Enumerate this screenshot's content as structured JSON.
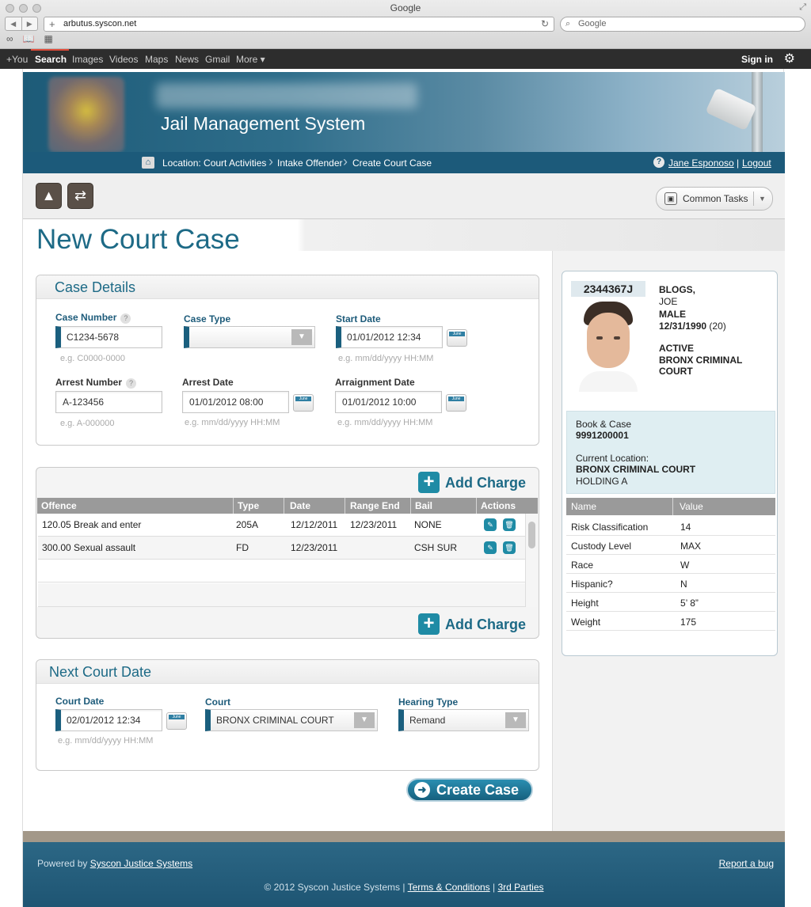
{
  "browser": {
    "window_title": "Google",
    "url": "arbutus.syscon.net",
    "search_placeholder": "Google",
    "google_bar": {
      "items": [
        "+You",
        "Search",
        "Images",
        "Videos",
        "Maps",
        "News",
        "Gmail",
        "More ▾"
      ],
      "signin": "Sign in"
    }
  },
  "app": {
    "system_title": "Jail Management System",
    "breadcrumbs": [
      "Location: Court Activities",
      "Intake Offender",
      "Create Court Case"
    ],
    "user_name": "Jane Esponoso",
    "logout": "Logout",
    "common_tasks": "Common Tasks",
    "page_title": "New Court Case"
  },
  "case_details": {
    "title": "Case Details",
    "case_number": {
      "label": "Case Number",
      "value": "C1234-5678",
      "hint": "e.g. C0000-0000"
    },
    "case_type": {
      "label": "Case Type",
      "value": ""
    },
    "start_date": {
      "label": "Start Date",
      "value": "01/01/2012  12:34",
      "hint": "e.g. mm/dd/yyyy  HH:MM"
    },
    "arrest_number": {
      "label": "Arrest Number",
      "value": "A-123456",
      "hint": "e.g. A-000000"
    },
    "arrest_date": {
      "label": "Arrest Date",
      "value": "01/01/2012  08:00",
      "hint": "e.g. mm/dd/yyyy  HH:MM"
    },
    "arraignment_date": {
      "label": "Arraignment Date",
      "value": "01/01/2012  10:00",
      "hint": "e.g. mm/dd/yyyy  HH:MM"
    }
  },
  "charges": {
    "add_label": "Add Charge",
    "columns": [
      "Offence",
      "Type",
      "Date",
      "Range End",
      "Bail",
      "Actions"
    ],
    "rows": [
      {
        "offence": "120.05 Break and enter",
        "type": "205A",
        "date": "12/12/2011",
        "range_end": "12/23/2011",
        "bail": "NONE"
      },
      {
        "offence": "300.00 Sexual assault",
        "type": "FD",
        "date": "12/23/2011",
        "range_end": "",
        "bail": "CSH SUR"
      }
    ]
  },
  "next_court": {
    "title": "Next Court Date",
    "court_date": {
      "label": "Court Date",
      "value": "02/01/2012  12:34",
      "hint": "e.g. mm/dd/yyyy  HH:MM"
    },
    "court": {
      "label": "Court",
      "value": "BRONX CRIMINAL COURT"
    },
    "hearing_type": {
      "label": "Hearing Type",
      "value": "Remand"
    }
  },
  "create_case": "Create Case",
  "offender": {
    "id": "2344367J",
    "last_name": "BLOGS,",
    "first_name": "JOE",
    "sex": "MALE",
    "dob": "12/31/1990",
    "age": "(20)",
    "status": "ACTIVE",
    "location_line1": "BRONX CRIMINAL",
    "location_line2": "COURT",
    "book_case_label": "Book & Case",
    "book_case": "9991200001",
    "current_location_label": "Current Location:",
    "current_location": "BRONX CRIMINAL COURT",
    "sub_location": "HOLDING A",
    "attr_header": {
      "name": "Name",
      "value": "Value"
    },
    "attributes": [
      {
        "name": "Risk Classification",
        "value": "14"
      },
      {
        "name": "Custody Level",
        "value": "MAX"
      },
      {
        "name": "Race",
        "value": "W"
      },
      {
        "name": "Hispanic?",
        "value": "N"
      },
      {
        "name": "Height",
        "value": "5’ 8”"
      },
      {
        "name": "Weight",
        "value": "175"
      }
    ]
  },
  "footer": {
    "powered_by": "Powered by",
    "company": "Syscon Justice Systems",
    "report_bug": "Report a bug",
    "copyright": "© 2012 Syscon Justice Systems |",
    "terms": "Terms & Conditions",
    "sep": "|",
    "third_parties": "3rd Parties"
  }
}
